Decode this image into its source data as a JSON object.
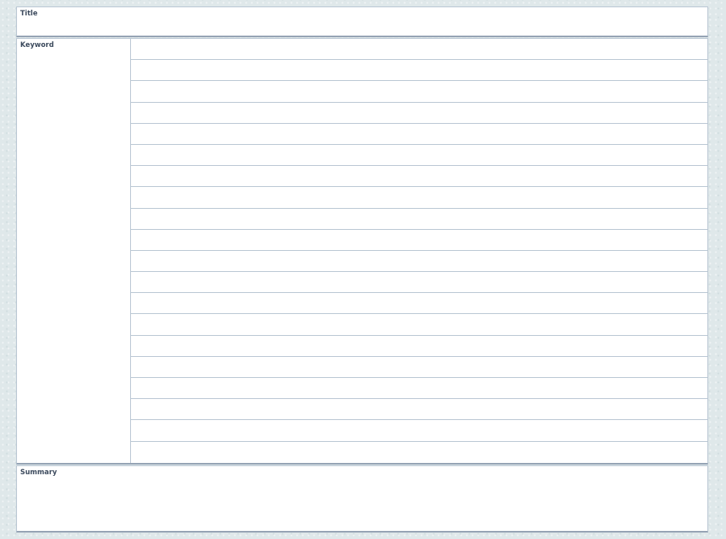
{
  "title_section": {
    "label": "Title"
  },
  "keyword_section": {
    "label": "Keyword"
  },
  "notes_section": {
    "line_count": 20
  },
  "summary_section": {
    "label": "Summary"
  },
  "colors": {
    "background": "#dfe8ea",
    "panel": "#ffffff",
    "rule_line": "#b9c6d3",
    "label_text": "#3d4b5e"
  }
}
